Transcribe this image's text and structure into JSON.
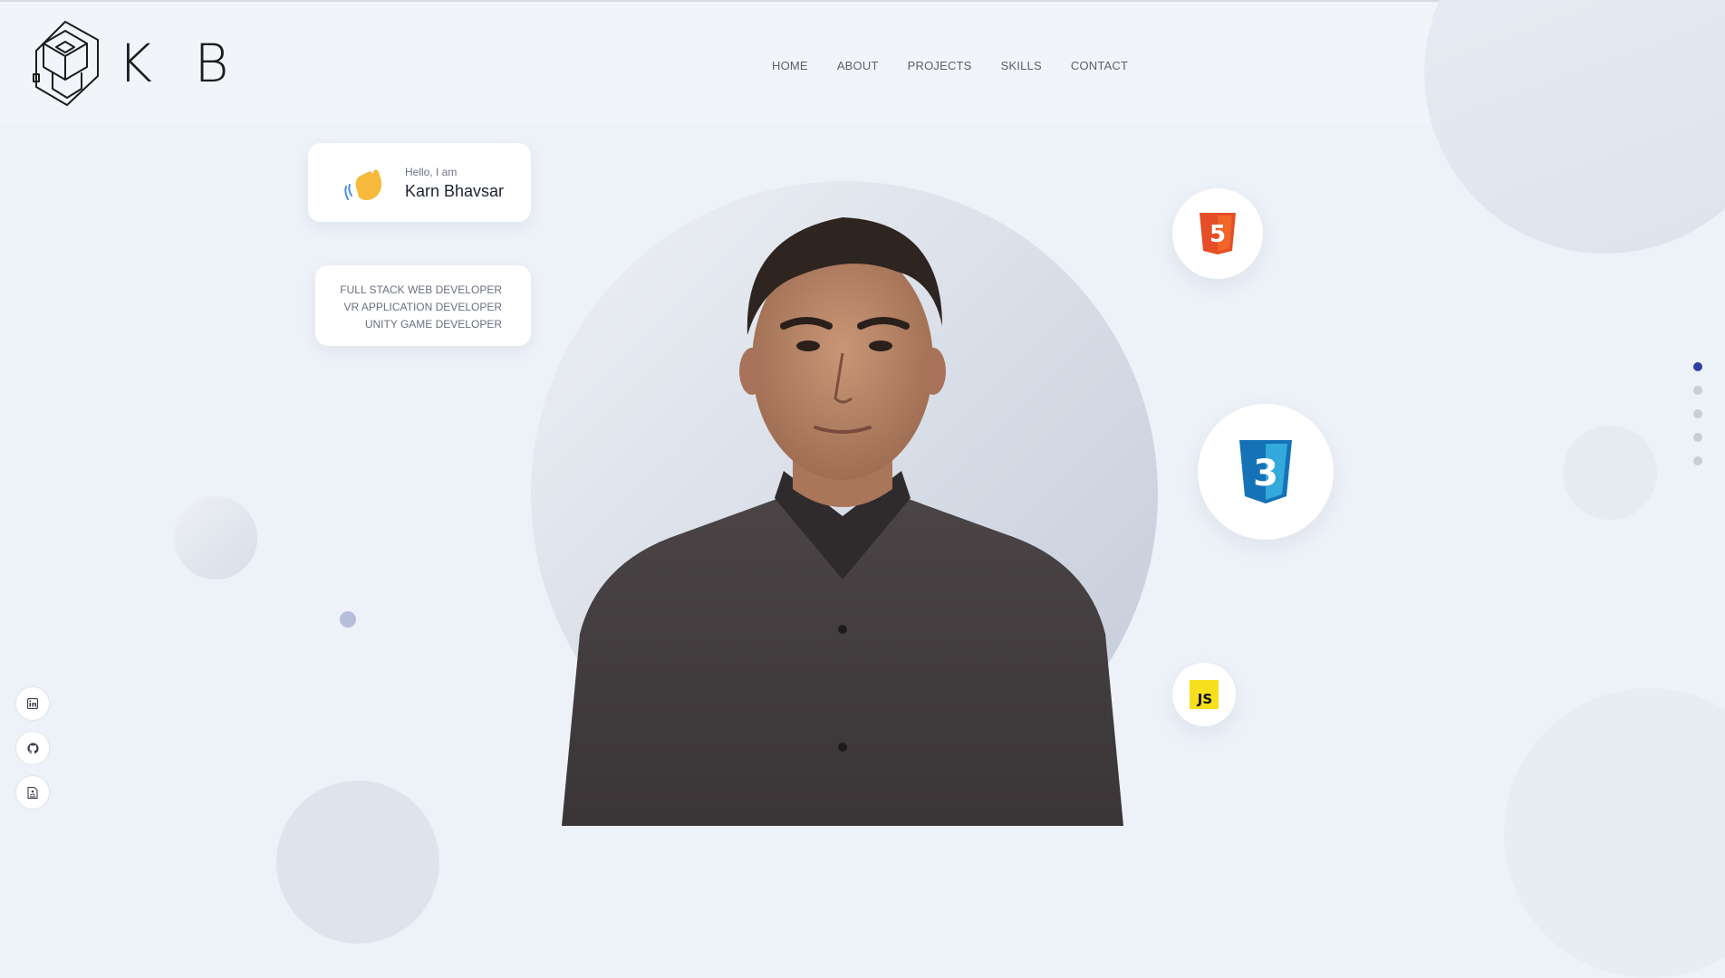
{
  "logo": {
    "text": "K B"
  },
  "nav": {
    "items": [
      "HOME",
      "ABOUT",
      "PROJECTS",
      "SKILLS",
      "CONTACT"
    ]
  },
  "intro": {
    "greeting": "Hello, I am",
    "name": "Karn Bhavsar",
    "roles": [
      "FULL STACK WEB DEVELOPER",
      "VR APPLICATION DEVELOPER",
      "UNITY GAME DEVELOPER"
    ]
  },
  "tech": {
    "html_digit": "5",
    "css_digit": "3",
    "js_label": "JS"
  },
  "pager": {
    "count": 5,
    "active_index": 0
  },
  "social": [
    "linkedin-icon",
    "github-icon",
    "resume-icon"
  ],
  "colors": {
    "background": "#edf1f8",
    "accent": "#2f3fa8",
    "html": "#e44d26",
    "css": "#1572b6",
    "js": "#f7df1e"
  }
}
